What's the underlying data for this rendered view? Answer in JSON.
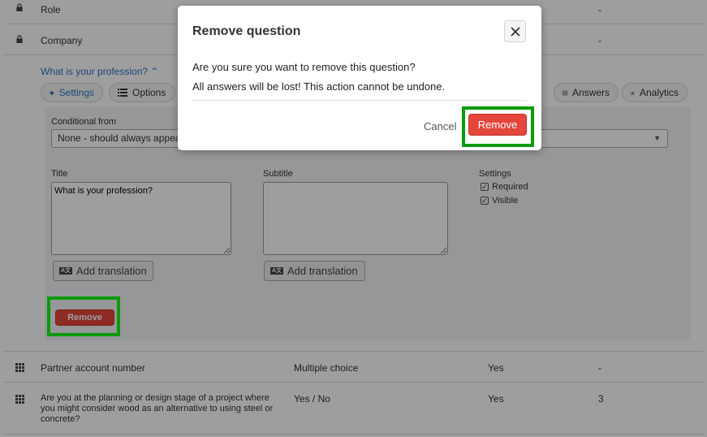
{
  "rows_top": [
    {
      "label": "Role",
      "dash": "-"
    },
    {
      "label": "Company",
      "dash": "-"
    }
  ],
  "question": {
    "link": "What is your profession? ⌃",
    "tabs": {
      "settings": "Settings",
      "options": "Options",
      "answers": "Answers",
      "analytics": "Analytics"
    },
    "conditional_label": "Conditional from",
    "conditional_value": "None - should always appear",
    "title_label": "Title",
    "title_value": "What is your profession?",
    "subtitle_label": "Subtitle",
    "subtitle_value": "",
    "settings_label": "Settings",
    "required_label": "Required",
    "visible_label": "Visible",
    "add_translation": "Add translation",
    "remove_label": "Remove"
  },
  "rows_bottom": [
    {
      "label": "Partner account number",
      "type": "Multiple choice",
      "required": "Yes",
      "count": "-"
    },
    {
      "label": "Are you at the planning or design stage of a project where you might consider wood as an alternative to using steel or concrete?",
      "type": "Yes / No",
      "required": "Yes",
      "count": "3"
    }
  ],
  "modal": {
    "title": "Remove question",
    "message1": "Are you sure you want to remove this question?",
    "message2": "All answers will be lost! This action cannot be undone.",
    "cancel": "Cancel",
    "remove": "Remove"
  },
  "colors": {
    "accent_red": "#e4463b",
    "link_blue": "#2f74c0",
    "highlight_green": "#0a9a0a"
  }
}
